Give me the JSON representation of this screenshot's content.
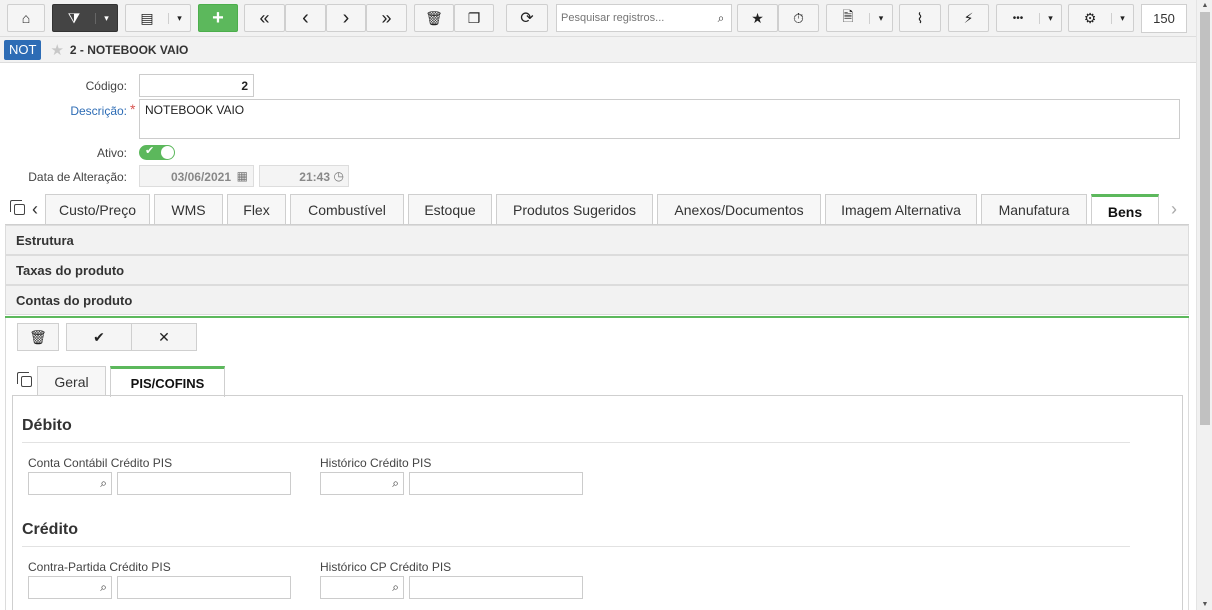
{
  "toolbar": {
    "icons": {
      "home": "⌂",
      "filter": "⧩",
      "list": "▤",
      "add": "+",
      "first": "«",
      "prev": "‹",
      "next": "›",
      "last": "»",
      "delete": "🗑",
      "copy": "❐",
      "refresh": "⟳",
      "search": "⌕",
      "favorite": "★",
      "timer": "⏱",
      "report": "🗎",
      "attach": "⌇",
      "flash": "⚡",
      "more": "•••",
      "settings": "⚙",
      "caret": "▾"
    },
    "search_placeholder": "Pesquisar registros...",
    "record_count": "150"
  },
  "header": {
    "tag": "NOT",
    "title": "2 - NOTEBOOK VAIO"
  },
  "form": {
    "codigo_label": "Código:",
    "codigo_value": "2",
    "descricao_label": "Descrição:",
    "descricao_value": "NOTEBOOK VAIO",
    "required_mark": "*",
    "ativo_label": "Ativo:",
    "data_alteracao_label": "Data de Alteração:",
    "data_value": "03/06/2021",
    "hora_value": "21:43"
  },
  "tabs": [
    {
      "label": "Custo/Preço"
    },
    {
      "label": "WMS"
    },
    {
      "label": "Flex"
    },
    {
      "label": "Combustível"
    },
    {
      "label": "Estoque"
    },
    {
      "label": "Produtos Sugeridos"
    },
    {
      "label": "Anexos/Documentos"
    },
    {
      "label": "Imagem Alternativa"
    },
    {
      "label": "Manufatura"
    },
    {
      "label": "Bens"
    }
  ],
  "accordions": [
    {
      "label": "Estrutura"
    },
    {
      "label": "Taxas do produto"
    },
    {
      "label": "Contas do produto"
    }
  ],
  "actions": {
    "delete": "🗑",
    "confirm": "✔",
    "cancel": "✕"
  },
  "subtabs": [
    {
      "label": "Geral"
    },
    {
      "label": "PIS/COFINS"
    }
  ],
  "debito": {
    "title": "Débito",
    "field1_label": "Conta Contábil Crédito PIS",
    "field2_label": "Histórico Crédito PIS"
  },
  "credito": {
    "title": "Crédito",
    "field1_label": "Contra-Partida Crédito PIS",
    "field2_label": "Histórico CP Crédito PIS"
  },
  "colors": {
    "accent_green": "#5cb85c",
    "tag_blue": "#2d6cb5",
    "required_red": "#d9534f"
  }
}
